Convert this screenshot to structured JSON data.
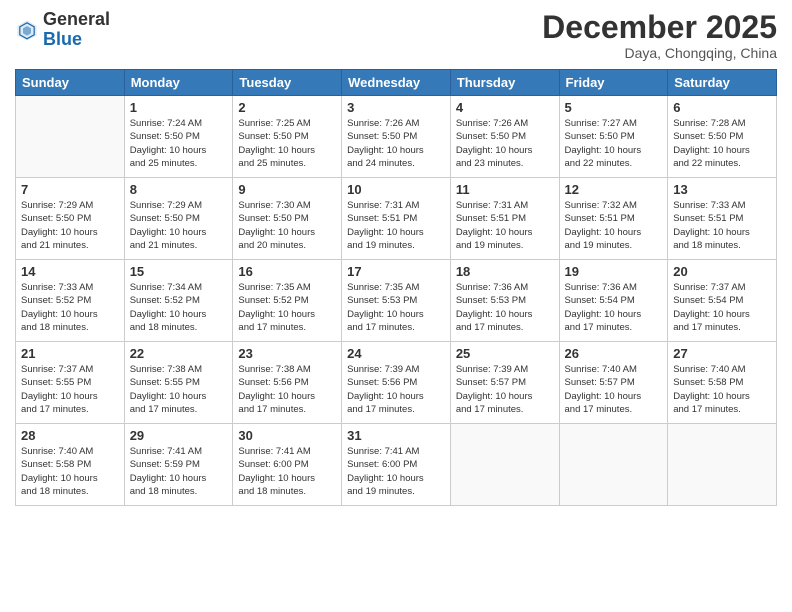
{
  "header": {
    "logo_general": "General",
    "logo_blue": "Blue",
    "month_title": "December 2025",
    "location": "Daya, Chongqing, China"
  },
  "days_of_week": [
    "Sunday",
    "Monday",
    "Tuesday",
    "Wednesday",
    "Thursday",
    "Friday",
    "Saturday"
  ],
  "weeks": [
    [
      {
        "day": "",
        "info": ""
      },
      {
        "day": "1",
        "info": "Sunrise: 7:24 AM\nSunset: 5:50 PM\nDaylight: 10 hours\nand 25 minutes."
      },
      {
        "day": "2",
        "info": "Sunrise: 7:25 AM\nSunset: 5:50 PM\nDaylight: 10 hours\nand 25 minutes."
      },
      {
        "day": "3",
        "info": "Sunrise: 7:26 AM\nSunset: 5:50 PM\nDaylight: 10 hours\nand 24 minutes."
      },
      {
        "day": "4",
        "info": "Sunrise: 7:26 AM\nSunset: 5:50 PM\nDaylight: 10 hours\nand 23 minutes."
      },
      {
        "day": "5",
        "info": "Sunrise: 7:27 AM\nSunset: 5:50 PM\nDaylight: 10 hours\nand 22 minutes."
      },
      {
        "day": "6",
        "info": "Sunrise: 7:28 AM\nSunset: 5:50 PM\nDaylight: 10 hours\nand 22 minutes."
      }
    ],
    [
      {
        "day": "7",
        "info": "Sunrise: 7:29 AM\nSunset: 5:50 PM\nDaylight: 10 hours\nand 21 minutes."
      },
      {
        "day": "8",
        "info": "Sunrise: 7:29 AM\nSunset: 5:50 PM\nDaylight: 10 hours\nand 21 minutes."
      },
      {
        "day": "9",
        "info": "Sunrise: 7:30 AM\nSunset: 5:50 PM\nDaylight: 10 hours\nand 20 minutes."
      },
      {
        "day": "10",
        "info": "Sunrise: 7:31 AM\nSunset: 5:51 PM\nDaylight: 10 hours\nand 19 minutes."
      },
      {
        "day": "11",
        "info": "Sunrise: 7:31 AM\nSunset: 5:51 PM\nDaylight: 10 hours\nand 19 minutes."
      },
      {
        "day": "12",
        "info": "Sunrise: 7:32 AM\nSunset: 5:51 PM\nDaylight: 10 hours\nand 19 minutes."
      },
      {
        "day": "13",
        "info": "Sunrise: 7:33 AM\nSunset: 5:51 PM\nDaylight: 10 hours\nand 18 minutes."
      }
    ],
    [
      {
        "day": "14",
        "info": "Sunrise: 7:33 AM\nSunset: 5:52 PM\nDaylight: 10 hours\nand 18 minutes."
      },
      {
        "day": "15",
        "info": "Sunrise: 7:34 AM\nSunset: 5:52 PM\nDaylight: 10 hours\nand 18 minutes."
      },
      {
        "day": "16",
        "info": "Sunrise: 7:35 AM\nSunset: 5:52 PM\nDaylight: 10 hours\nand 17 minutes."
      },
      {
        "day": "17",
        "info": "Sunrise: 7:35 AM\nSunset: 5:53 PM\nDaylight: 10 hours\nand 17 minutes."
      },
      {
        "day": "18",
        "info": "Sunrise: 7:36 AM\nSunset: 5:53 PM\nDaylight: 10 hours\nand 17 minutes."
      },
      {
        "day": "19",
        "info": "Sunrise: 7:36 AM\nSunset: 5:54 PM\nDaylight: 10 hours\nand 17 minutes."
      },
      {
        "day": "20",
        "info": "Sunrise: 7:37 AM\nSunset: 5:54 PM\nDaylight: 10 hours\nand 17 minutes."
      }
    ],
    [
      {
        "day": "21",
        "info": "Sunrise: 7:37 AM\nSunset: 5:55 PM\nDaylight: 10 hours\nand 17 minutes."
      },
      {
        "day": "22",
        "info": "Sunrise: 7:38 AM\nSunset: 5:55 PM\nDaylight: 10 hours\nand 17 minutes."
      },
      {
        "day": "23",
        "info": "Sunrise: 7:38 AM\nSunset: 5:56 PM\nDaylight: 10 hours\nand 17 minutes."
      },
      {
        "day": "24",
        "info": "Sunrise: 7:39 AM\nSunset: 5:56 PM\nDaylight: 10 hours\nand 17 minutes."
      },
      {
        "day": "25",
        "info": "Sunrise: 7:39 AM\nSunset: 5:57 PM\nDaylight: 10 hours\nand 17 minutes."
      },
      {
        "day": "26",
        "info": "Sunrise: 7:40 AM\nSunset: 5:57 PM\nDaylight: 10 hours\nand 17 minutes."
      },
      {
        "day": "27",
        "info": "Sunrise: 7:40 AM\nSunset: 5:58 PM\nDaylight: 10 hours\nand 17 minutes."
      }
    ],
    [
      {
        "day": "28",
        "info": "Sunrise: 7:40 AM\nSunset: 5:58 PM\nDaylight: 10 hours\nand 18 minutes."
      },
      {
        "day": "29",
        "info": "Sunrise: 7:41 AM\nSunset: 5:59 PM\nDaylight: 10 hours\nand 18 minutes."
      },
      {
        "day": "30",
        "info": "Sunrise: 7:41 AM\nSunset: 6:00 PM\nDaylight: 10 hours\nand 18 minutes."
      },
      {
        "day": "31",
        "info": "Sunrise: 7:41 AM\nSunset: 6:00 PM\nDaylight: 10 hours\nand 19 minutes."
      },
      {
        "day": "",
        "info": ""
      },
      {
        "day": "",
        "info": ""
      },
      {
        "day": "",
        "info": ""
      }
    ]
  ]
}
